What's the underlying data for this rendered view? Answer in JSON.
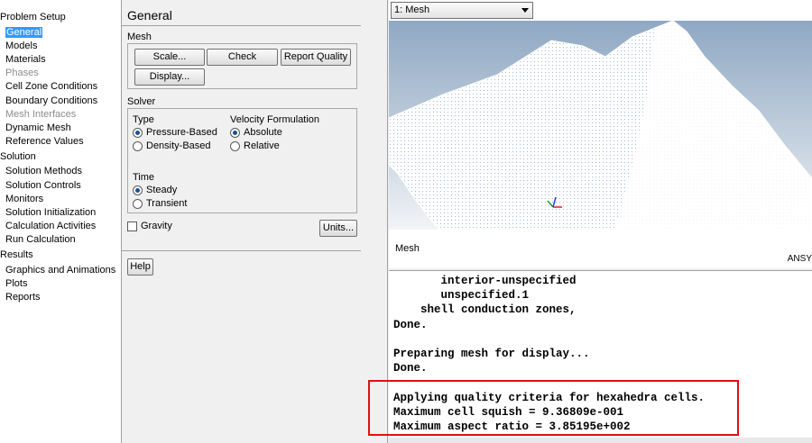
{
  "tree": {
    "sections": [
      {
        "label": "Problem Setup",
        "items": [
          {
            "label": "General",
            "selected": true
          },
          {
            "label": "Models"
          },
          {
            "label": "Materials"
          },
          {
            "label": "Phases",
            "disabled": true
          },
          {
            "label": "Cell Zone Conditions"
          },
          {
            "label": "Boundary Conditions"
          },
          {
            "label": "Mesh Interfaces",
            "disabled": true
          },
          {
            "label": "Dynamic Mesh"
          },
          {
            "label": "Reference Values"
          }
        ]
      },
      {
        "label": "Solution",
        "items": [
          {
            "label": "Solution Methods"
          },
          {
            "label": "Solution Controls"
          },
          {
            "label": "Monitors"
          },
          {
            "label": "Solution Initialization"
          },
          {
            "label": "Calculation Activities"
          },
          {
            "label": "Run Calculation"
          }
        ]
      },
      {
        "label": "Results",
        "items": [
          {
            "label": "Graphics and Animations"
          },
          {
            "label": "Plots"
          },
          {
            "label": "Reports"
          }
        ]
      }
    ]
  },
  "panel": {
    "title": "General",
    "mesh": {
      "label": "Mesh",
      "scale": "Scale...",
      "check": "Check",
      "report_quality": "Report Quality",
      "display": "Display..."
    },
    "solver": {
      "label": "Solver",
      "type_label": "Type",
      "pressure_based": "Pressure-Based",
      "density_based": "Density-Based",
      "velocity_label": "Velocity Formulation",
      "absolute": "Absolute",
      "relative": "Relative",
      "time_label": "Time",
      "steady": "Steady",
      "transient": "Transient"
    },
    "gravity": "Gravity",
    "units": "Units...",
    "help": "Help"
  },
  "graphics": {
    "view_selected": "1: Mesh",
    "caption": "Mesh",
    "brand": "ANSY",
    "colors": {
      "x_axis": "#e02020",
      "y_axis": "#20a020",
      "z_axis": "#2040e0"
    }
  },
  "console": {
    "lines": [
      "       interior-unspecified",
      "       unspecified.1",
      "    shell conduction zones,",
      "Done.",
      "",
      "Preparing mesh for display...",
      "Done.",
      "",
      "Applying quality criteria for hexahedra cells.",
      "Maximum cell squish = 9.36809e-001",
      "Maximum aspect ratio = 3.85195e+002"
    ]
  }
}
